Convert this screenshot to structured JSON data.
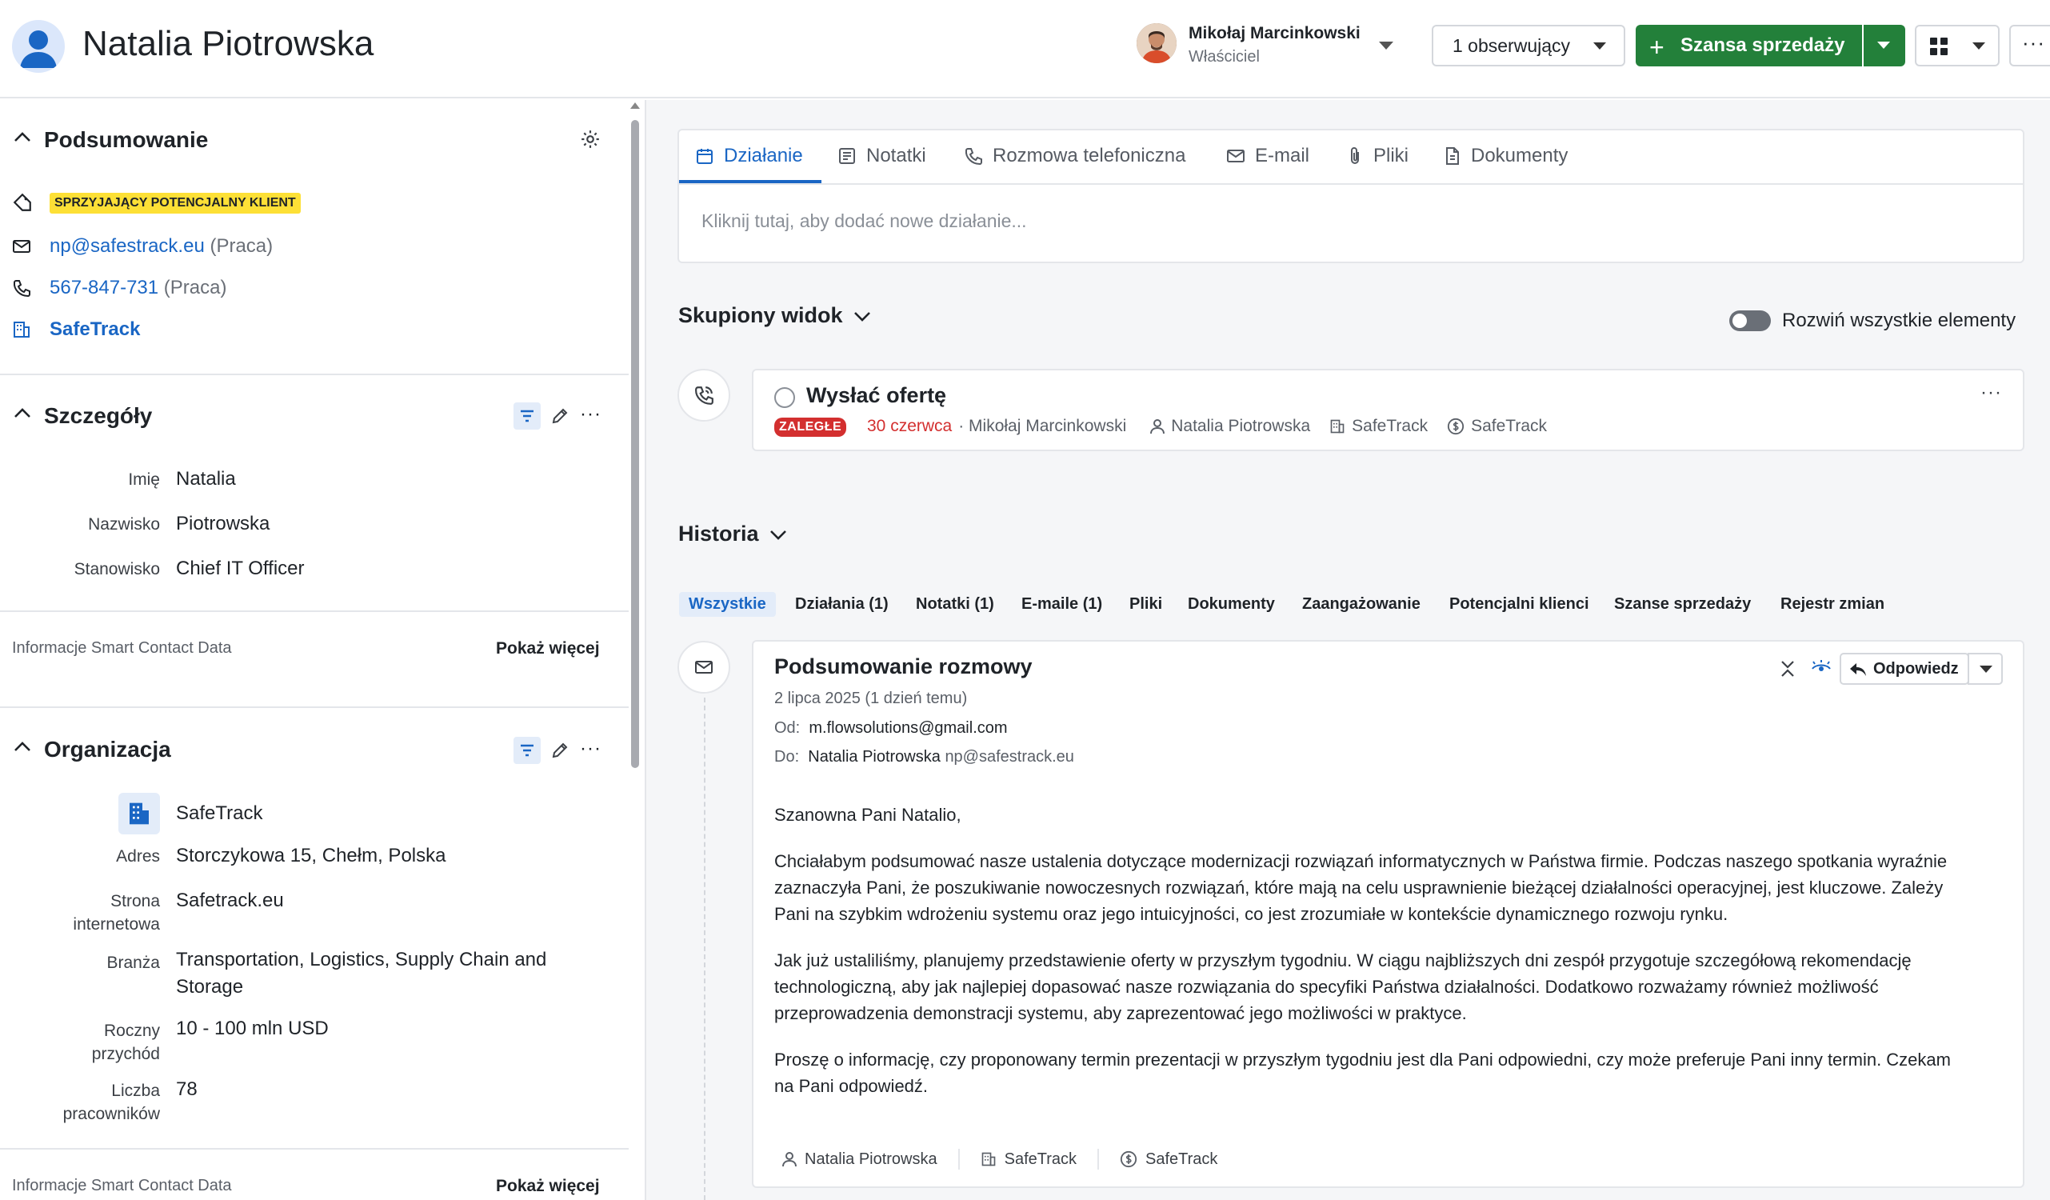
{
  "header": {
    "person_name": "Natalia Piotrowska",
    "owner_name": "Mikołaj Marcinkowski",
    "owner_role": "Właściciel",
    "followers_label": "1 obserwujący",
    "deal_button_label": "Szansa sprzedaży",
    "more_label": "···"
  },
  "summary": {
    "title": "Podsumowanie",
    "tag": "SPRZYJAJĄCY POTENCJALNY KLIENT",
    "email": "np@safestrack.eu",
    "email_type": "(Praca)",
    "phone": "567-847-731",
    "phone_type": "(Praca)",
    "company": "SafeTrack"
  },
  "details": {
    "title": "Szczegóły",
    "fields": [
      {
        "label": "Imię",
        "value": "Natalia"
      },
      {
        "label": "Nazwisko",
        "value": "Piotrowska"
      },
      {
        "label": "Stanowisko",
        "value": "Chief IT Officer"
      }
    ],
    "smart_label": "Informacje Smart Contact Data",
    "show_more": "Pokaż więcej"
  },
  "organization": {
    "title": "Organizacja",
    "name": "SafeTrack",
    "address_label": "Adres",
    "address": "Storczykowa 15, Chełm, Polska",
    "website_label_1": "Strona",
    "website_label_2": "internetowa",
    "website": "Safetrack.eu",
    "industry_label": "Branża",
    "industry_1": "Transportation, Logistics, Supply Chain and",
    "industry_2": "Storage",
    "revenue_label_1": "Roczny",
    "revenue_label_2": "przychód",
    "revenue": "10 - 100 mln USD",
    "employees_label_1": "Liczba",
    "employees_label_2": "pracowników",
    "employees": "78",
    "smart_label": "Informacje Smart Contact Data",
    "show_more": "Pokaż więcej"
  },
  "composer": {
    "tabs": [
      "Działanie",
      "Notatki",
      "Rozmowa telefoniczna",
      "E-mail",
      "Pliki",
      "Dokumenty"
    ],
    "placeholder": "Kliknij tutaj, aby dodać nowe działanie..."
  },
  "focus": {
    "title": "Skupiony widok",
    "toggle_label": "Rozwiń wszystkie elementy",
    "activity": {
      "title": "Wysłać ofertę",
      "badge": "ZALEGŁE",
      "date": "30 czerwca",
      "owner": "· Mikołaj Marcinkowski",
      "person": "Natalia Piotrowska",
      "org": "SafeTrack",
      "deal": "SafeTrack"
    }
  },
  "history": {
    "title": "Historia",
    "tabs": [
      "Wszystkie",
      "Działania (1)",
      "Notatki (1)",
      "E-maile (1)",
      "Pliki",
      "Dokumenty",
      "Zaangażowanie",
      "Potencjalni klienci",
      "Szanse sprzedaży",
      "Rejestr zmian"
    ],
    "email": {
      "subject": "Podsumowanie rozmowy",
      "date": "2 lipca 2025 (1 dzień temu)",
      "from_label": "Od:",
      "from": "m.flowsolutions@gmail.com",
      "to_label": "Do:",
      "to_name": "Natalia Piotrowska",
      "to_email": "np@safestrack.eu",
      "reply_label": "Odpowiedz",
      "body": [
        "Szanowna Pani Natalio,",
        "Chciałabym podsumować nasze ustalenia dotyczące modernizacji rozwiązań informatycznych w Państwa firmie. Podczas naszego spotkania wyraźnie zaznaczyła Pani, że poszukiwanie nowoczesnych rozwiązań, które mają na celu usprawnienie bieżącej działalności operacyjnej, jest kluczowe. Zależy Pani na szybkim wdrożeniu systemu oraz jego intuicyjności, co jest zrozumiałe w kontekście dynamicznego rozwoju rynku.",
        "Jak już ustaliliśmy, planujemy przedstawienie oferty w przyszłym tygodniu. W ciągu najbliższych dni zespół przygotuje szczegółową rekomendację technologiczną, aby jak najlepiej dopasować nasze rozwiązania do specyfiki Państwa działalności. Dodatkowo rozważamy również możliwość przeprowadzenia demonstracji systemu, aby zaprezentować jego możliwości w praktyce.",
        "Proszę o informację, czy proponowany termin prezentacji w przyszłym tygodniu jest dla Pani odpowiedni, czy może preferuje Pani inny termin. Czekam na Pani odpowiedź."
      ],
      "footer_person": "Natalia Piotrowska",
      "footer_org": "SafeTrack",
      "footer_deal": "SafeTrack"
    }
  },
  "colors": {
    "accent": "#1a66c4",
    "primary_button": "#23803a",
    "tag_yellow": "#fde036",
    "overdue_red": "#d32f2f"
  }
}
